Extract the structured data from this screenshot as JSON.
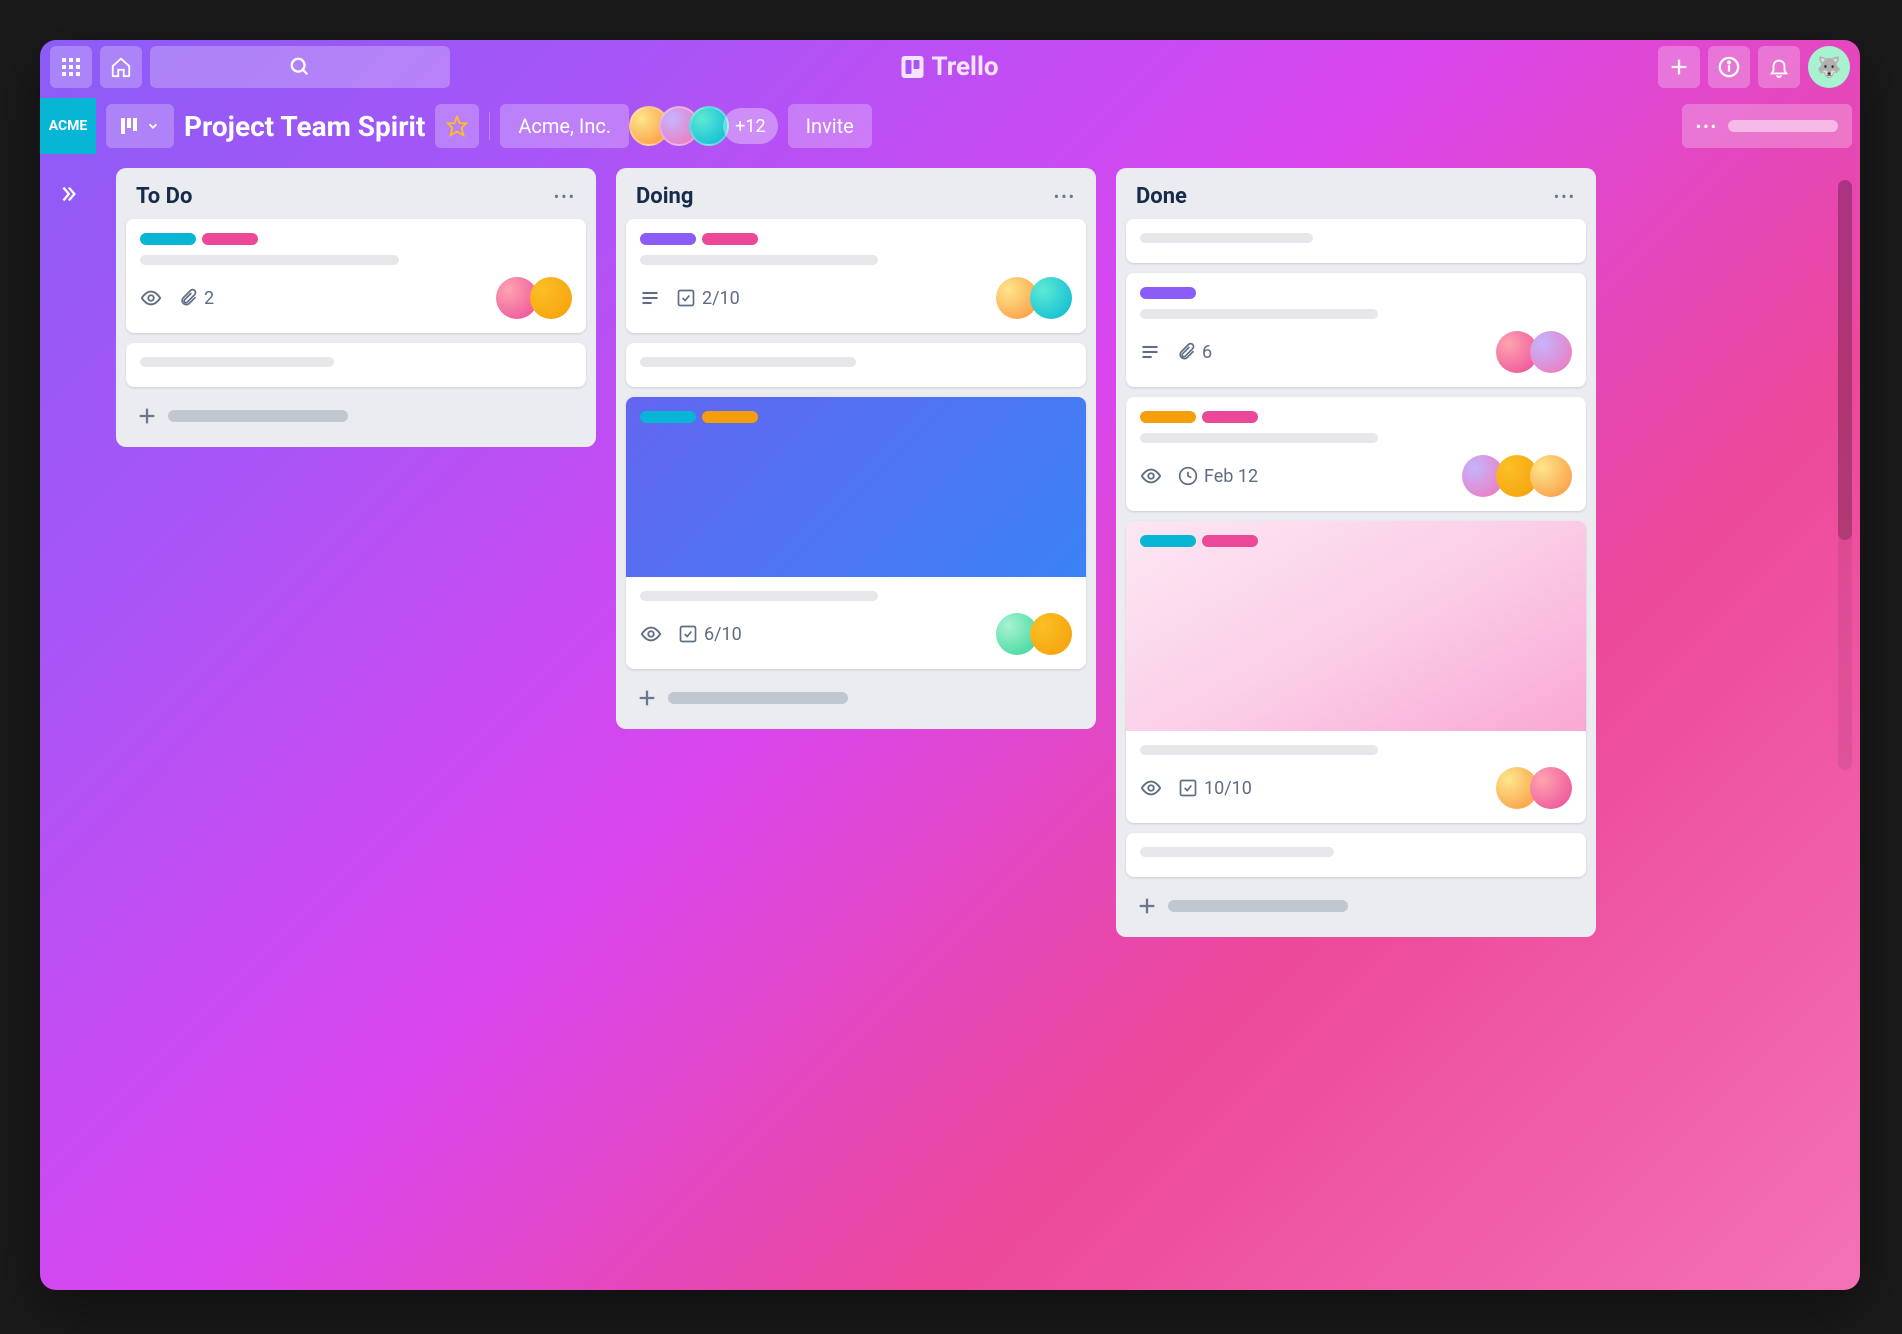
{
  "app": {
    "name": "Trello"
  },
  "board": {
    "title": "Project Team Spirit",
    "team": "Acme, Inc.",
    "team_short": "ACME",
    "extra_members": "+12",
    "invite_label": "Invite"
  },
  "lists": [
    {
      "title": "To Do",
      "cards": [
        {
          "labels": [
            "cyan",
            "pink"
          ],
          "attachments": "2"
        },
        {
          "labels": []
        }
      ]
    },
    {
      "title": "Doing",
      "cards": [
        {
          "labels": [
            "purple",
            "pink"
          ],
          "checklist": "2/10"
        },
        {
          "labels": []
        },
        {
          "labels": [
            "cyan",
            "yellow"
          ],
          "checklist": "6/10",
          "cover": "blue"
        }
      ]
    },
    {
      "title": "Done",
      "cards": [
        {
          "labels": []
        },
        {
          "labels": [
            "purple"
          ],
          "attachments": "6"
        },
        {
          "labels": [
            "yellow",
            "pink"
          ],
          "due": "Feb 12"
        },
        {
          "labels": [
            "cyan",
            "pink"
          ],
          "checklist": "10/10",
          "cover": "pink"
        },
        {
          "labels": []
        }
      ]
    }
  ]
}
